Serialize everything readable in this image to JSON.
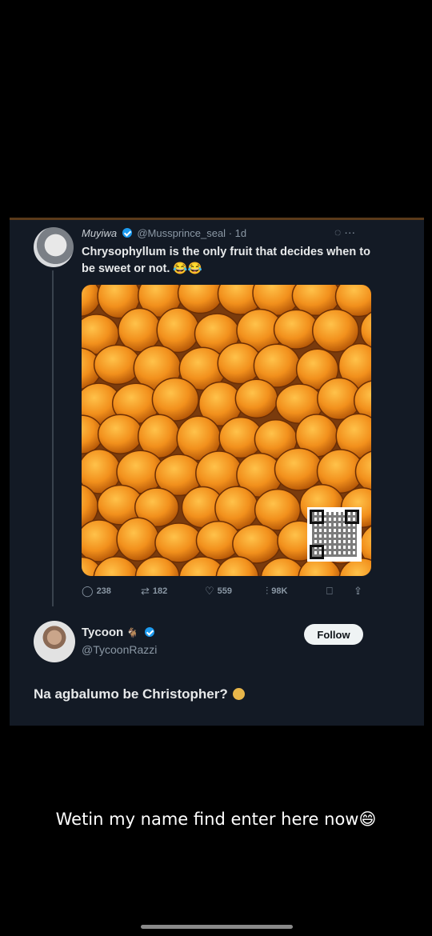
{
  "post": {
    "author_name": "Muyiwa",
    "author_handle": "@Mussprince_seal",
    "time": "· 1d",
    "text": "Chrysophyllum is the only fruit that decides when to be sweet or not.",
    "emoji": "😂😂",
    "more_label": "···",
    "image_alt": "pile of orange agbalumo fruits"
  },
  "stats": {
    "replies": "238",
    "reposts": "182",
    "likes": "559",
    "views": "98K"
  },
  "reply_user": {
    "name": "Tycoon",
    "handle": "@TycoonRazzi",
    "follow_label": "Follow"
  },
  "reply_text": "Na agbalumo be Christopher?",
  "caption": "Wetin my name find enter here now😄",
  "colors": {
    "background": "#000000",
    "card": "#131a25",
    "accent": "#1d9bf0",
    "fruit": "#f2901c"
  }
}
